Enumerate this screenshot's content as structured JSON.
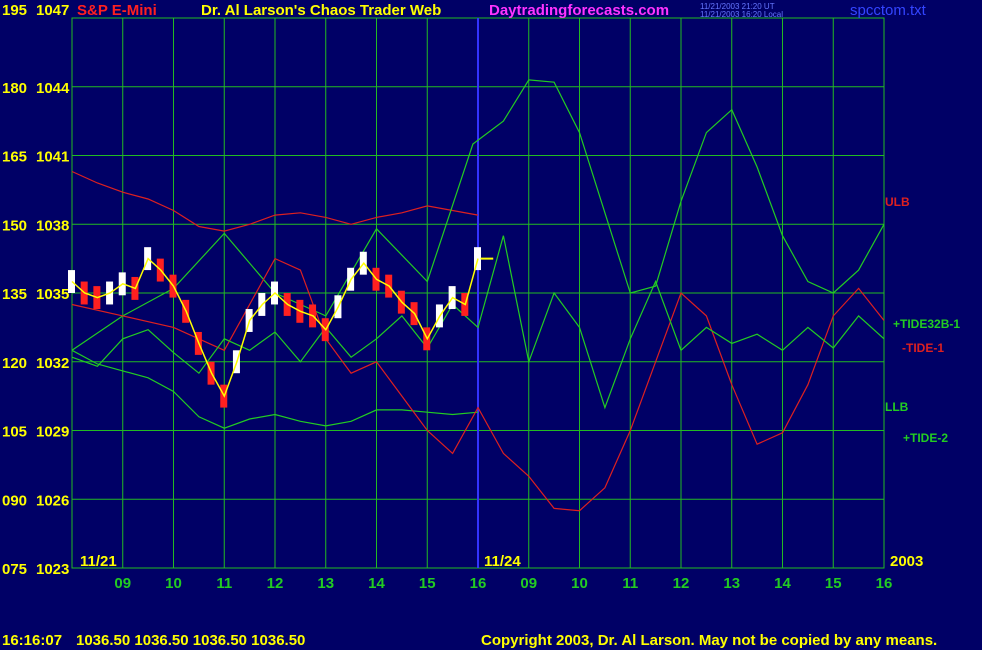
{
  "header": {
    "left_axis_top_1": "195",
    "left_axis_top_2": "1047",
    "symbol": "S&P E-Mini",
    "site_title": "Dr. Al Larson's Chaos Trader Web",
    "site_url": "Daytradingforecasts.com",
    "time_ut": "11/21/2003 21:20 UT",
    "time_local": "11/21/2003 16:20 Local",
    "file_name": "spcctom.txt"
  },
  "footer": {
    "quote_time": "16:16:07",
    "quote_values": "1036.50 1036.50 1036.50 1036.50",
    "copyright": "Copyright 2003, Dr. Al Larson. May not be copied by any means."
  },
  "colors": {
    "background": "#000066",
    "grid": "#22bb22",
    "price_bar": "#ffffff",
    "price_bar_down": "#ff2020",
    "tide_green": "#22cc22",
    "band_red": "#dd2020",
    "yellow": "#ffff00",
    "blue_axis": "#3333ff",
    "magenta": "#ff33ff"
  },
  "chart_data": {
    "type": "line",
    "yaxis_left_outer": [
      "195",
      "180",
      "165",
      "150",
      "135",
      "120",
      "105",
      "090",
      "075"
    ],
    "yaxis_left_inner": [
      "1047",
      "1044",
      "1041",
      "1038",
      "1035",
      "1032",
      "1029",
      "1026",
      "1023"
    ],
    "ylim_price": [
      1023,
      1047
    ],
    "xaxis_tick_labels": [
      "09",
      "10",
      "11",
      "12",
      "13",
      "14",
      "15",
      "16",
      "09",
      "10",
      "11",
      "12",
      "13",
      "14",
      "15",
      "16"
    ],
    "date_labels": [
      "11/21",
      "11/24",
      "2003"
    ],
    "right_labels": [
      "ULB",
      "+TIDE32B-1",
      "-TIDE-1",
      "LLB",
      "+TIDE-2"
    ],
    "last_price": 1036.5,
    "series": [
      {
        "name": "ULB",
        "color": "#dd2020",
        "x": [
          0,
          0.5,
          1,
          1.5,
          2,
          2.5,
          3,
          3.5,
          4,
          4.5,
          5,
          5.5,
          6,
          6.5,
          7,
          7.5,
          8
        ],
        "y": [
          1040.3,
          1039.8,
          1039.4,
          1039.1,
          1038.6,
          1037.9,
          1037.7,
          1038.0,
          1038.4,
          1038.5,
          1038.3,
          1038.0,
          1038.3,
          1038.5,
          1038.8,
          1038.6,
          1038.4
        ]
      },
      {
        "name": "LLB",
        "color": "#22cc22",
        "x": [
          0,
          0.5,
          1,
          1.5,
          2,
          2.5,
          3,
          3.5,
          4,
          4.5,
          5,
          5.5,
          6,
          6.5,
          7,
          7.5,
          8
        ],
        "y": [
          1032.5,
          1031.9,
          1031.6,
          1031.3,
          1030.7,
          1029.6,
          1029.1,
          1029.5,
          1029.7,
          1029.4,
          1029.2,
          1029.4,
          1029.9,
          1029.9,
          1029.8,
          1029.7,
          1029.8
        ]
      },
      {
        "name": "+TIDE32B-1",
        "color": "#22cc22",
        "x": [
          0,
          1,
          2,
          3,
          4,
          5,
          6,
          7,
          7.9,
          8.5,
          9,
          9.5,
          10,
          10.5,
          11,
          11.5,
          12,
          12.5,
          13,
          13.5,
          14,
          14.5,
          15,
          15.5,
          16
        ],
        "y": [
          1032.5,
          1034.0,
          1035.2,
          1037.6,
          1035.0,
          1034.0,
          1037.8,
          1035.5,
          1041.5,
          1042.5,
          1044.3,
          1044.2,
          1042.0,
          1038.5,
          1035.0,
          1035.3,
          1039.0,
          1042.0,
          1043.0,
          1040.5,
          1037.5,
          1035.5,
          1035.0,
          1036.0,
          1038.0
        ]
      },
      {
        "name": "-TIDE-1",
        "color": "#dd2020",
        "x": [
          0,
          1,
          2,
          3,
          4,
          4.5,
          5,
          5.5,
          6,
          6.5,
          7,
          7.5,
          8,
          8.5,
          9,
          9.5,
          10,
          10.5,
          11,
          11.5,
          12,
          12.5,
          13,
          13.5,
          14,
          14.5,
          15,
          15.5,
          16
        ],
        "y": [
          1034.5,
          1034.0,
          1033.5,
          1032.5,
          1036.5,
          1036.0,
          1033.0,
          1031.5,
          1032.0,
          1030.5,
          1029.0,
          1028.0,
          1030.0,
          1028.0,
          1027.0,
          1025.6,
          1025.5,
          1026.5,
          1029.0,
          1032.0,
          1035.0,
          1034.0,
          1031.0,
          1028.4,
          1028.9,
          1031.0,
          1034.0,
          1035.2,
          1033.8
        ]
      },
      {
        "name": "+TIDE-2",
        "color": "#22cc22",
        "x": [
          0,
          0.5,
          1,
          1.5,
          2,
          2.5,
          3,
          3.5,
          4,
          4.5,
          5,
          5.5,
          6,
          6.5,
          7,
          7.5,
          8,
          8.5,
          9,
          9.5,
          10,
          10.5,
          11,
          11.5,
          12,
          12.5,
          13,
          13.5,
          14,
          14.5,
          15,
          15.5,
          16
        ],
        "y": [
          1032.2,
          1031.8,
          1033.0,
          1033.4,
          1032.4,
          1031.5,
          1033.0,
          1032.5,
          1033.3,
          1032.0,
          1033.5,
          1032.2,
          1033.0,
          1034.0,
          1032.6,
          1034.5,
          1033.5,
          1037.5,
          1032.0,
          1035.0,
          1033.5,
          1030.0,
          1033.0,
          1035.5,
          1032.5,
          1033.5,
          1032.8,
          1033.2,
          1032.5,
          1033.5,
          1032.6,
          1034.0,
          1033.0
        ]
      },
      {
        "name": "Price",
        "color": "#ffffff",
        "x": [
          0,
          0.25,
          0.5,
          0.75,
          1,
          1.25,
          1.5,
          1.75,
          2,
          2.25,
          2.5,
          2.75,
          3,
          3.25,
          3.5,
          3.75,
          4,
          4.25,
          4.5,
          4.75,
          5,
          5.25,
          5.5,
          5.75,
          6,
          6.25,
          6.5,
          6.75,
          7,
          7.25,
          7.5,
          7.75,
          8
        ],
        "y": [
          1035.5,
          1035.0,
          1034.8,
          1035.0,
          1035.4,
          1035.2,
          1036.5,
          1036.0,
          1035.3,
          1034.2,
          1032.8,
          1031.5,
          1030.5,
          1032.0,
          1033.8,
          1034.5,
          1035.0,
          1034.5,
          1034.2,
          1034.0,
          1033.4,
          1034.4,
          1035.6,
          1036.3,
          1035.6,
          1035.3,
          1034.6,
          1034.1,
          1033.0,
          1034.0,
          1034.8,
          1034.5,
          1036.5
        ]
      }
    ]
  }
}
